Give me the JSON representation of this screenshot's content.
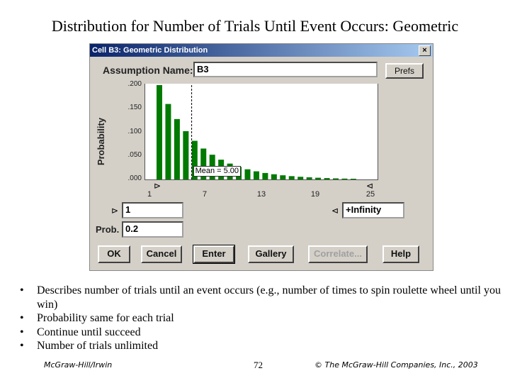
{
  "slide": {
    "title": "Distribution for Number of Trials Until Event Occurs: Geometric",
    "bullets": [
      "Describes number of trials until an event occurs (e.g., number of times to spin roulette wheel until you win)",
      "Probability same for each trial",
      "Continue until succeed",
      "Number of trials unlimited"
    ],
    "bullet_symbol": "•",
    "footer_left": "McGraw-Hill/Irwin",
    "page_number": "72",
    "footer_right": "© The McGraw-Hill Companies, Inc., 2003"
  },
  "dialog": {
    "title": "Cell B3:  Geometric Distribution",
    "close_glyph": "×",
    "assumption_label": "Assumption Name:",
    "assumption_value": "B3",
    "prefs_label": "Prefs",
    "lower_bound_glyph": "⊳",
    "lower_bound_value": "1",
    "upper_bound_glyph": "⊲",
    "upper_bound_value": "+Infinity",
    "prob_label": "Prob.",
    "prob_value": "0.2",
    "buttons": {
      "ok": "OK",
      "cancel": "Cancel",
      "enter": "Enter",
      "gallery": "Gallery",
      "correlate": "Correlate...",
      "help": "Help"
    },
    "mean_label": "Mean = 5.00"
  },
  "chart_data": {
    "type": "bar",
    "title": "",
    "xlabel": "",
    "ylabel": "Probability",
    "ylim": [
      0,
      0.2
    ],
    "xlim": [
      1,
      25
    ],
    "y_ticks": [
      ".000",
      ".050",
      ".100",
      ".150",
      ".200"
    ],
    "x_ticks": [
      "1",
      "7",
      "13",
      "19",
      "25"
    ],
    "mean": 5.0,
    "x": [
      1,
      2,
      3,
      4,
      5,
      6,
      7,
      8,
      9,
      10,
      11,
      12,
      13,
      14,
      15,
      16,
      17,
      18,
      19,
      20,
      21,
      22,
      23
    ],
    "values": [
      0.2,
      0.16,
      0.128,
      0.1024,
      0.0819,
      0.0655,
      0.0524,
      0.0419,
      0.0336,
      0.0268,
      0.0215,
      0.0172,
      0.0137,
      0.011,
      0.0088,
      0.007,
      0.0056,
      0.0045,
      0.0036,
      0.0029,
      0.0023,
      0.0018,
      0.0015
    ],
    "bar_color": "#007a00"
  }
}
